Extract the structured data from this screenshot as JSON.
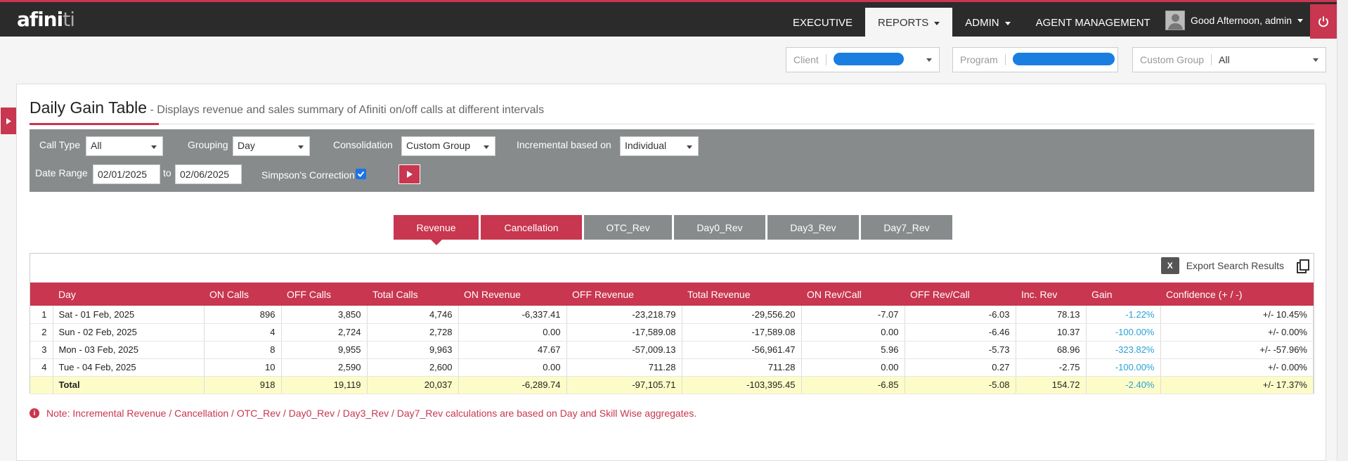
{
  "app": {
    "logo_main": "afini",
    "logo_accent": "ti"
  },
  "nav": {
    "executive": "EXECUTIVE",
    "reports": "REPORTS",
    "admin": "ADMIN",
    "agent_management": "AGENT MANAGEMENT"
  },
  "user": {
    "greeting": "Good Afternoon, admin"
  },
  "selectors": {
    "client_label": "Client",
    "program_label": "Program",
    "custom_group_label": "Custom Group",
    "custom_group_value": "All"
  },
  "page": {
    "title": "Daily Gain Table",
    "subtitle": " - Displays revenue and sales summary of Afiniti on/off calls at different intervals"
  },
  "filters": {
    "call_type_label": "Call Type",
    "call_type_value": "All",
    "grouping_label": "Grouping",
    "grouping_value": "Day",
    "consolidation_label": "Consolidation",
    "consolidation_value": "Custom Group",
    "incremental_label": "Incremental based on",
    "incremental_value": "Individual",
    "date_range_label": "Date Range",
    "date_from": "02/01/2025",
    "to_label": "to",
    "date_to": "02/06/2025",
    "simpson_label": "Simpson's Correction",
    "simpson_checked": true
  },
  "tabs": [
    "Revenue",
    "Cancellation",
    "OTC_Rev",
    "Day0_Rev",
    "Day3_Rev",
    "Day7_Rev"
  ],
  "export": {
    "label": "Export Search Results"
  },
  "table": {
    "headers": [
      "",
      "Day",
      "ON Calls",
      "OFF Calls",
      "Total Calls",
      "ON Revenue",
      "OFF Revenue",
      "Total Revenue",
      "ON Rev/Call",
      "OFF Rev/Call",
      "Inc. Rev",
      "Gain",
      "Confidence (+ / -)"
    ],
    "rows": [
      [
        "1",
        "Sat - 01 Feb, 2025",
        "896",
        "3,850",
        "4,746",
        "-6,337.41",
        "-23,218.79",
        "-29,556.20",
        "-7.07",
        "-6.03",
        "78.13",
        "-1.22%",
        "+/- 10.45%"
      ],
      [
        "2",
        "Sun - 02 Feb, 2025",
        "4",
        "2,724",
        "2,728",
        "0.00",
        "-17,589.08",
        "-17,589.08",
        "0.00",
        "-6.46",
        "10.37",
        "-100.00%",
        "+/- 0.00%"
      ],
      [
        "3",
        "Mon - 03 Feb, 2025",
        "8",
        "9,955",
        "9,963",
        "47.67",
        "-57,009.13",
        "-56,961.47",
        "5.96",
        "-5.73",
        "68.96",
        "-323.82%",
        "+/- -57.96%"
      ],
      [
        "4",
        "Tue - 04 Feb, 2025",
        "10",
        "2,590",
        "2,600",
        "0.00",
        "711.28",
        "711.28",
        "0.00",
        "0.27",
        "-2.75",
        "-100.00%",
        "+/- 0.00%"
      ]
    ],
    "total": [
      "",
      "Total",
      "918",
      "19,119",
      "20,037",
      "-6,289.74",
      "-97,105.71",
      "-103,395.45",
      "-6.85",
      "-5.08",
      "154.72",
      "-2.40%",
      "+/- 17.37%"
    ]
  },
  "note": "Note: Incremental Revenue / Cancellation / OTC_Rev / Day0_Rev / Day3_Rev / Day7_Rev calculations are based on Day and Skill Wise aggregates.",
  "colors": {
    "accent": "#c8364f",
    "topbar": "#2b2b2b",
    "filter_bar": "#888b8c",
    "gain": "#2aa0d6",
    "total_row": "#fdfcc8"
  }
}
